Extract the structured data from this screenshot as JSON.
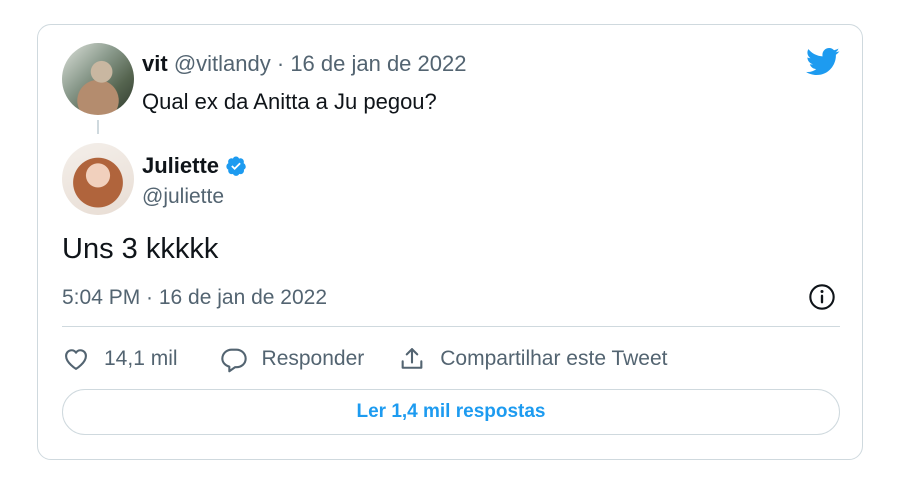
{
  "reply_to": {
    "name": "vit",
    "handle": "@vitlandy",
    "date": "· 16 de jan de 2022",
    "text": "Qual ex da Anitta a Ju pegou?"
  },
  "author": {
    "name": "Juliette",
    "handle": "@juliette",
    "verified": true
  },
  "tweet": {
    "text": "Uns 3 kkkkk",
    "timestamp": "5:04 PM · 16 de jan de 2022"
  },
  "actions": {
    "likes": "14,1 mil",
    "reply_label": "Responder",
    "share_label": "Compartilhar este Tweet"
  },
  "replies_button": "Ler 1,4 mil respostas",
  "colors": {
    "accent": "#1d9bf0",
    "text": "#0f1419",
    "muted": "#536471",
    "border": "#cfd9de"
  },
  "icons": [
    "twitter-bird-icon",
    "verified-badge-icon",
    "info-icon",
    "heart-icon",
    "reply-icon",
    "share-icon"
  ]
}
